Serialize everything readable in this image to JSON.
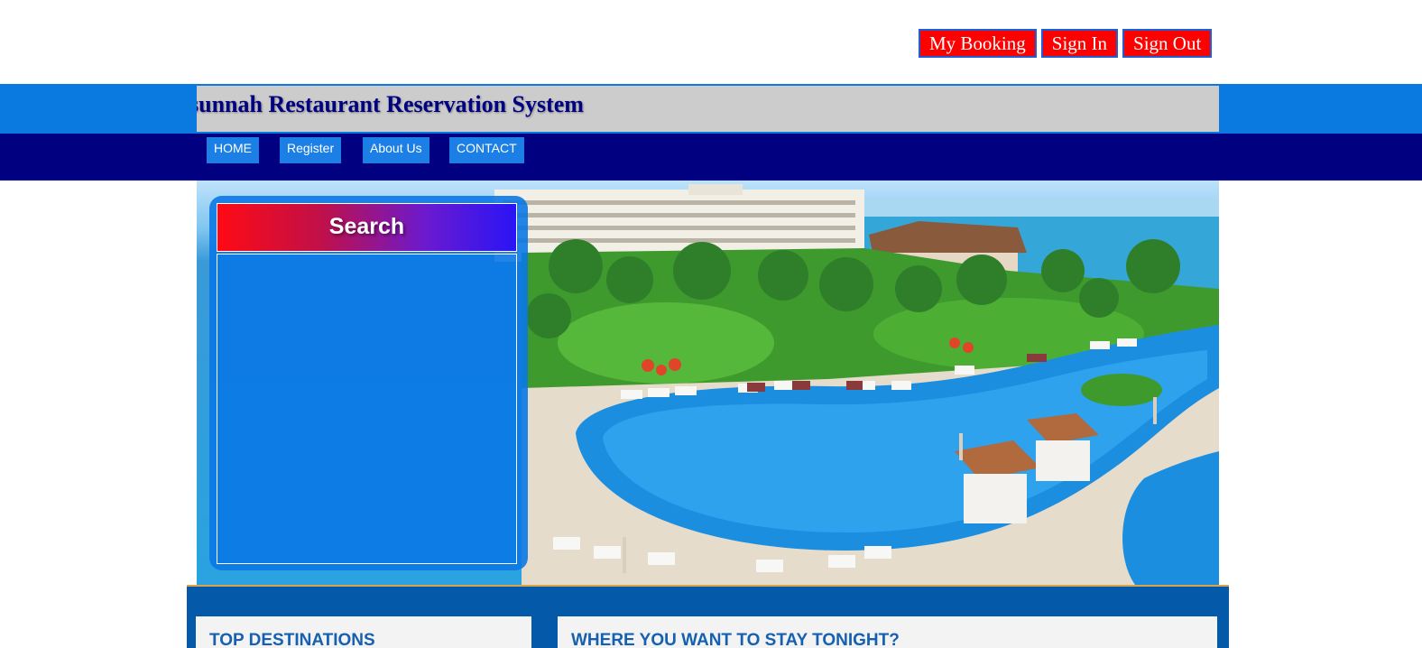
{
  "header": {
    "actions": [
      "My Booking",
      "Sign In",
      "Sign Out"
    ]
  },
  "site": {
    "title": "sunnah Restaurant Reservation System"
  },
  "nav": {
    "items": [
      "HOME",
      "Register",
      "About Us",
      "CONTACT"
    ]
  },
  "search": {
    "title": "Search"
  },
  "content": {
    "top_destinations_title": "TOP DESTINATIONS",
    "stay_title": "WHERE YOU WANT TO STAY TONIGHT?"
  },
  "colors": {
    "accent_red": "#ff0000",
    "navy": "#000080",
    "bright_blue": "#0a7ae0",
    "content_blue": "#045aa8"
  }
}
